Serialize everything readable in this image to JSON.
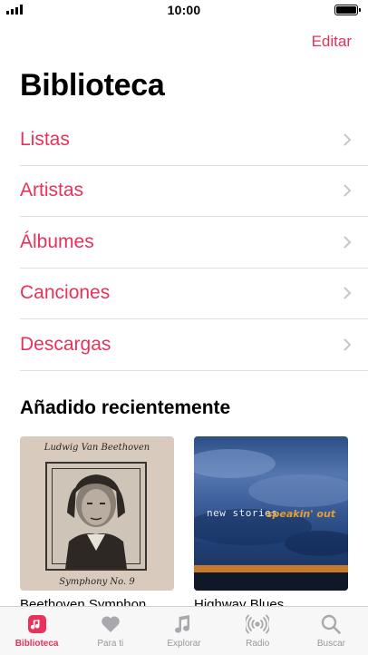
{
  "status_bar": {
    "time": "10:00"
  },
  "header": {
    "edit_label": "Editar",
    "title": "Biblioteca"
  },
  "library": {
    "items": [
      {
        "label": "Listas"
      },
      {
        "label": "Artistas"
      },
      {
        "label": "Álbumes"
      },
      {
        "label": "Canciones"
      },
      {
        "label": "Descargas"
      }
    ]
  },
  "recently_added": {
    "title": "Añadido recientemente",
    "albums": [
      {
        "title": "Beethoven Symphon",
        "cover_top_text": "Ludwig Van Beethoven",
        "cover_bottom_text": "Symphony No. 9"
      },
      {
        "title": "Highway Blues",
        "cover_text": "new stories",
        "cover_text_2": "speakin' out"
      }
    ]
  },
  "tab_bar": {
    "tabs": [
      {
        "label": "Biblioteca",
        "icon": "library-icon",
        "active": true
      },
      {
        "label": "Para ti",
        "icon": "heart-icon",
        "active": false
      },
      {
        "label": "Explorar",
        "icon": "music-note-icon",
        "active": false
      },
      {
        "label": "Radio",
        "icon": "radio-icon",
        "active": false
      },
      {
        "label": "Buscar",
        "icon": "search-icon",
        "active": false
      }
    ]
  },
  "colors": {
    "accent": "#e8325b",
    "separator": "#dedee3",
    "inactive_tab": "#999999",
    "chevron": "#c7c7cc"
  }
}
